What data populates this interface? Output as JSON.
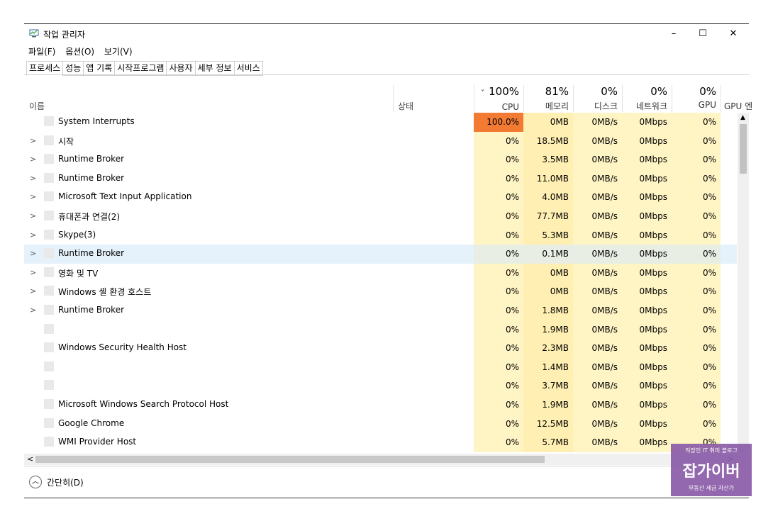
{
  "window": {
    "title": "작업 관리자",
    "controls": {
      "minimize": "–",
      "maximize": "☐",
      "close": "✕"
    }
  },
  "menu": [
    "파일(F)",
    "옵션(O)",
    "보기(V)"
  ],
  "tabs": [
    "프로세스",
    "성능",
    "앱 기록",
    "시작프로그램",
    "사용자",
    "세부 정보",
    "서비스"
  ],
  "columns": {
    "name": "이름",
    "status": "상태",
    "cpu": {
      "percent": "100%",
      "label": "CPU"
    },
    "memory": {
      "percent": "81%",
      "label": "메모리"
    },
    "disk": {
      "percent": "0%",
      "label": "디스크"
    },
    "network": {
      "percent": "0%",
      "label": "네트워크"
    },
    "gpu": {
      "percent": "0%",
      "label": "GPU"
    },
    "gpu_engine": "GPU 엔"
  },
  "rows": [
    {
      "name": "System Interrupts",
      "expandable": false,
      "cpu": "100.0%",
      "mem": "0MB",
      "disk": "0MB/s",
      "net": "0Mbps",
      "gpu": "0%"
    },
    {
      "name": "시작",
      "expandable": true,
      "cpu": "0%",
      "mem": "18.5MB",
      "disk": "0MB/s",
      "net": "0Mbps",
      "gpu": "0%"
    },
    {
      "name": "Runtime Broker",
      "expandable": true,
      "cpu": "0%",
      "mem": "3.5MB",
      "disk": "0MB/s",
      "net": "0Mbps",
      "gpu": "0%"
    },
    {
      "name": "Runtime Broker",
      "expandable": true,
      "cpu": "0%",
      "mem": "11.0MB",
      "disk": "0MB/s",
      "net": "0Mbps",
      "gpu": "0%"
    },
    {
      "name": "Microsoft Text Input Application",
      "expandable": true,
      "cpu": "0%",
      "mem": "4.0MB",
      "disk": "0MB/s",
      "net": "0Mbps",
      "gpu": "0%"
    },
    {
      "name": "휴대폰과 연결(2)",
      "expandable": true,
      "cpu": "0%",
      "mem": "77.7MB",
      "disk": "0MB/s",
      "net": "0Mbps",
      "gpu": "0%"
    },
    {
      "name": "Skype(3)",
      "expandable": true,
      "cpu": "0%",
      "mem": "5.3MB",
      "disk": "0MB/s",
      "net": "0Mbps",
      "gpu": "0%"
    },
    {
      "name": "Runtime Broker",
      "expandable": true,
      "selected": true,
      "cpu": "0%",
      "mem": "0.1MB",
      "disk": "0MB/s",
      "net": "0Mbps",
      "gpu": "0%"
    },
    {
      "name": "영화 및 TV",
      "expandable": true,
      "cpu": "0%",
      "mem": "0MB",
      "disk": "0MB/s",
      "net": "0Mbps",
      "gpu": "0%"
    },
    {
      "name": "Windows 셸 환경 호스트",
      "expandable": true,
      "cpu": "0%",
      "mem": "0MB",
      "disk": "0MB/s",
      "net": "0Mbps",
      "gpu": "0%"
    },
    {
      "name": "Runtime Broker",
      "expandable": true,
      "cpu": "0%",
      "mem": "1.8MB",
      "disk": "0MB/s",
      "net": "0Mbps",
      "gpu": "0%"
    },
    {
      "name": "",
      "expandable": false,
      "cpu": "0%",
      "mem": "1.9MB",
      "disk": "0MB/s",
      "net": "0Mbps",
      "gpu": "0%"
    },
    {
      "name": "Windows Security Health Host",
      "expandable": false,
      "cpu": "0%",
      "mem": "2.3MB",
      "disk": "0MB/s",
      "net": "0Mbps",
      "gpu": "0%"
    },
    {
      "name": "",
      "expandable": false,
      "cpu": "0%",
      "mem": "1.4MB",
      "disk": "0MB/s",
      "net": "0Mbps",
      "gpu": "0%"
    },
    {
      "name": "",
      "expandable": false,
      "cpu": "0%",
      "mem": "3.7MB",
      "disk": "0MB/s",
      "net": "0Mbps",
      "gpu": "0%"
    },
    {
      "name": "Microsoft Windows Search Protocol Host",
      "expandable": false,
      "cpu": "0%",
      "mem": "1.9MB",
      "disk": "0MB/s",
      "net": "0Mbps",
      "gpu": "0%"
    },
    {
      "name": "Google Chrome",
      "expandable": false,
      "cpu": "0%",
      "mem": "12.5MB",
      "disk": "0MB/s",
      "net": "0Mbps",
      "gpu": "0%"
    },
    {
      "name": "WMI Provider Host",
      "expandable": false,
      "cpu": "0%",
      "mem": "5.7MB",
      "disk": "0MB/s",
      "net": "0Mbps",
      "gpu": "0%"
    }
  ],
  "footer": {
    "fewer_details": "간단히(D)"
  },
  "watermark": {
    "line1": "직장인 IT 취미 블로그",
    "line2": "잡가이버",
    "line3": "부동산 세금 자산가"
  },
  "colors": {
    "cpu_hot": "#f27a33",
    "heat_light": "#fff4c4",
    "selected_row": "#e5f1fb"
  }
}
